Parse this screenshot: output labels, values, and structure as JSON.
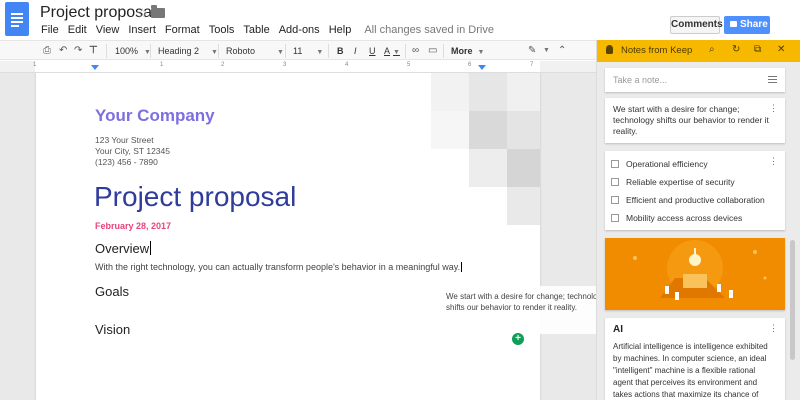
{
  "header": {
    "title": "Project proposal",
    "menu": [
      "File",
      "Edit",
      "View",
      "Insert",
      "Format",
      "Tools",
      "Table",
      "Add-ons",
      "Help"
    ],
    "saved_status": "All changes saved in Drive",
    "comments_label": "Comments",
    "share_label": "Share"
  },
  "toolbar": {
    "zoom": "100%",
    "style": "Heading 2",
    "font": "Roboto",
    "size": "11",
    "bold": "B",
    "italic": "I",
    "underline": "U",
    "text_color": "A",
    "more": "More"
  },
  "ruler": {
    "numbers": [
      "1",
      "1",
      "2",
      "3",
      "4",
      "5",
      "6",
      "7"
    ]
  },
  "document": {
    "company": "Your Company",
    "address_line1": "123 Your Street",
    "address_line2": "Your City, ST 12345",
    "phone": "(123) 456 - 7890",
    "title": "Project proposal",
    "date": "February 28, 2017",
    "heading_overview": "Overview",
    "paragraph": "With the right technology, you can actually transform people's behavior in a meaningful way.",
    "heading_goals": "Goals",
    "heading_vision": "Vision"
  },
  "drag_ghost": {
    "text": "We start with a desire for change; technology shifts our behavior to render it reality."
  },
  "keep": {
    "title": "Notes from Keep",
    "take_note_placeholder": "Take a note...",
    "note1": "We start with a desire for change; technology shifts our behavior to render it reality.",
    "checklist": [
      "Operational efficiency",
      "Reliable expertise of security",
      "Efficient and productive collaboration",
      "Mobility access across devices"
    ],
    "ai_title": "AI",
    "ai_body": "Artificial intelligence is intelligence exhibited by machines. In computer science, an ideal \"intelligent\" machine is a flexible rational agent that perceives its environment and takes actions that maximize its chance of"
  },
  "colors": {
    "company": "#7e6fe0",
    "title": "#2f3c9c",
    "date": "#e8447c",
    "keep_header": "#f7b800",
    "share": "#4d90fe"
  }
}
